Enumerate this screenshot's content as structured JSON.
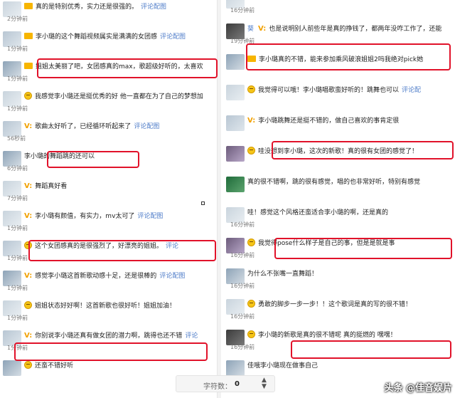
{
  "left": [
    {
      "text": "真的是特别优秀，实力还是很强的。",
      "action": "评论配图",
      "time": "2分钟前",
      "icon": "folder"
    },
    {
      "text": "李小璐的这个舞蹈视频属实是满满的女团感",
      "action": "评论配图",
      "time": "1分钟前",
      "icon": "folder"
    },
    {
      "text": "姐姐太美丽了吧，女团感真的max，歌超级好听的，太喜欢",
      "action": "",
      "time": "1分钟前",
      "icon": "folder"
    },
    {
      "text": "我感觉李小璐还是挺优秀的好 他一直都在为了自己的梦想加",
      "action": "",
      "time": "1分钟前",
      "icon": "emoji"
    },
    {
      "text": "歌曲太好听了，已经循环听起来了",
      "action": "评论配图",
      "time": "56秒前",
      "icon": "v"
    },
    {
      "text": "李小璐的舞蹈跳的还可以",
      "action": "",
      "time": "6分钟前",
      "icon": "none"
    },
    {
      "text": "舞蹈真好看",
      "action": "",
      "time": "7分钟前",
      "icon": "v"
    },
    {
      "text": "李小璐有颜值，有实力，mv太可了",
      "action": "评论配图",
      "time": "1分钟前",
      "icon": "v"
    },
    {
      "text": "这个女团感真的是很强烈了，好漂亮的姐姐。",
      "action": "评论",
      "time": "1分钟前",
      "icon": "emoji"
    },
    {
      "text": "感觉李小璐这首新歌动感十足，还是很棒的",
      "action": "评论配图",
      "time": "1分钟前",
      "icon": "v"
    },
    {
      "text": "姐姐状态好好啊！这首新歌也很好听！姐姐加油！",
      "action": "",
      "time": "1分钟前",
      "icon": "emoji"
    },
    {
      "text": "你别说李小璐还真有做女团的潜力啊，跳得也还不错",
      "action": "评论",
      "time": "1分钟前",
      "icon": "v"
    },
    {
      "text": "还蛮不错好听",
      "action": "",
      "time": "",
      "icon": "emoji"
    }
  ],
  "right": [
    {
      "name": "",
      "text": "",
      "action": "",
      "time": "16分钟前",
      "icon": "none"
    },
    {
      "name": "葵",
      "text": "也是说明别人前些年是真的挣钱了，都两年没咋工作了，还能",
      "action": "",
      "time": "19分钟前",
      "icon": "v"
    },
    {
      "name": "",
      "text": "李小璐真的不错，能来参加乘风破浪姐姐2吗我绝对pick她",
      "action": "",
      "time": "",
      "icon": "folder"
    },
    {
      "name": "",
      "text": "我觉得可以哦！李小璐唱歌蛮好听的！跳舞也可以",
      "action": "评论配",
      "time": "",
      "icon": "emoji"
    },
    {
      "name": "",
      "text": "李小璐跳舞还是挺不错的，做自己喜欢的事肯定很",
      "action": "",
      "time": "",
      "icon": "v"
    },
    {
      "name": "",
      "text": "哇没想到李小璐，这次的新歌！真的很有女团的感觉了！",
      "action": "",
      "time": "",
      "icon": "emoji"
    },
    {
      "name": "",
      "text": "真的很不错啊，跳的很有感觉，唱的也非常好听，特别有感觉",
      "action": "",
      "time": "",
      "icon": "none"
    },
    {
      "name": "",
      "text": "哇！感觉这个风格还蛮适合李小璐的啊，还是真的",
      "action": "",
      "time": "16分钟前",
      "icon": "none"
    },
    {
      "name": "",
      "text": "我觉得pose什么样子是自己的事，但是是就是事",
      "action": "",
      "time": "16分钟前",
      "icon": "emoji"
    },
    {
      "name": "",
      "text": "为什么不张嘴一直舞蹈！",
      "action": "",
      "time": "16分钟前",
      "icon": "none"
    },
    {
      "name": "",
      "text": "勇敢的脚步一步一步！！这个歌词是真的写的很不错！",
      "action": "",
      "time": "16分钟前",
      "icon": "emoji"
    },
    {
      "name": "",
      "text": "李小璐的新歌是真的很不错呢 真的挺燃的 嘿嘿！",
      "action": "",
      "time": "16分钟前",
      "icon": "emoji"
    },
    {
      "name": "",
      "text": "佳哦李小璐现在做事自己",
      "action": "",
      "time": "",
      "icon": "none"
    }
  ],
  "counter": {
    "label": "字符数：",
    "value": "0"
  },
  "watermark": "头条 @佳音娱片"
}
